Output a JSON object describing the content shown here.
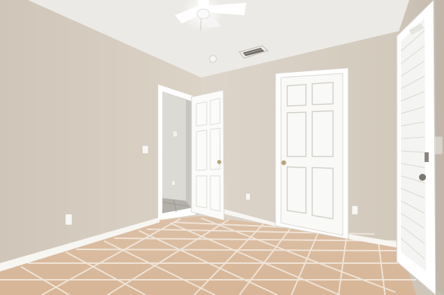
{
  "photo": {
    "subject": "empty bedroom",
    "watermark_text": ""
  },
  "colors": {
    "wall": "#d8d0c4",
    "wall_shadow": "#c9c0b3",
    "ceiling": "#eeece8",
    "trim": "#ffffff",
    "floor_tile": "#d9b89c",
    "grout": "#efe6dc"
  },
  "icons": {
    "ceiling_fan": "ceiling-fan-icon",
    "vent": "air-vent-icon",
    "outlet": "outlet-icon",
    "switch": "light-switch-icon",
    "door_knob": "door-knob-icon"
  }
}
